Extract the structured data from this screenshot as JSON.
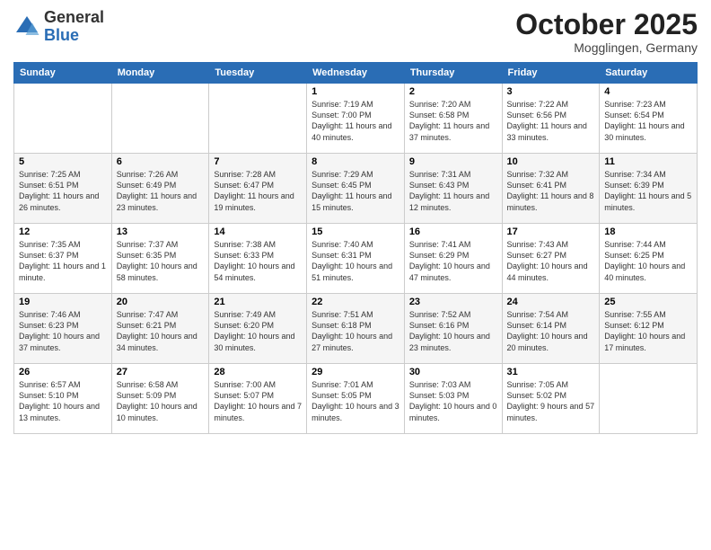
{
  "logo": {
    "general": "General",
    "blue": "Blue"
  },
  "title": {
    "month": "October 2025",
    "location": "Mogglingen, Germany"
  },
  "headers": [
    "Sunday",
    "Monday",
    "Tuesday",
    "Wednesday",
    "Thursday",
    "Friday",
    "Saturday"
  ],
  "weeks": [
    [
      {
        "day": "",
        "info": ""
      },
      {
        "day": "",
        "info": ""
      },
      {
        "day": "",
        "info": ""
      },
      {
        "day": "1",
        "info": "Sunrise: 7:19 AM\nSunset: 7:00 PM\nDaylight: 11 hours and 40 minutes."
      },
      {
        "day": "2",
        "info": "Sunrise: 7:20 AM\nSunset: 6:58 PM\nDaylight: 11 hours and 37 minutes."
      },
      {
        "day": "3",
        "info": "Sunrise: 7:22 AM\nSunset: 6:56 PM\nDaylight: 11 hours and 33 minutes."
      },
      {
        "day": "4",
        "info": "Sunrise: 7:23 AM\nSunset: 6:54 PM\nDaylight: 11 hours and 30 minutes."
      }
    ],
    [
      {
        "day": "5",
        "info": "Sunrise: 7:25 AM\nSunset: 6:51 PM\nDaylight: 11 hours and 26 minutes."
      },
      {
        "day": "6",
        "info": "Sunrise: 7:26 AM\nSunset: 6:49 PM\nDaylight: 11 hours and 23 minutes."
      },
      {
        "day": "7",
        "info": "Sunrise: 7:28 AM\nSunset: 6:47 PM\nDaylight: 11 hours and 19 minutes."
      },
      {
        "day": "8",
        "info": "Sunrise: 7:29 AM\nSunset: 6:45 PM\nDaylight: 11 hours and 15 minutes."
      },
      {
        "day": "9",
        "info": "Sunrise: 7:31 AM\nSunset: 6:43 PM\nDaylight: 11 hours and 12 minutes."
      },
      {
        "day": "10",
        "info": "Sunrise: 7:32 AM\nSunset: 6:41 PM\nDaylight: 11 hours and 8 minutes."
      },
      {
        "day": "11",
        "info": "Sunrise: 7:34 AM\nSunset: 6:39 PM\nDaylight: 11 hours and 5 minutes."
      }
    ],
    [
      {
        "day": "12",
        "info": "Sunrise: 7:35 AM\nSunset: 6:37 PM\nDaylight: 11 hours and 1 minute."
      },
      {
        "day": "13",
        "info": "Sunrise: 7:37 AM\nSunset: 6:35 PM\nDaylight: 10 hours and 58 minutes."
      },
      {
        "day": "14",
        "info": "Sunrise: 7:38 AM\nSunset: 6:33 PM\nDaylight: 10 hours and 54 minutes."
      },
      {
        "day": "15",
        "info": "Sunrise: 7:40 AM\nSunset: 6:31 PM\nDaylight: 10 hours and 51 minutes."
      },
      {
        "day": "16",
        "info": "Sunrise: 7:41 AM\nSunset: 6:29 PM\nDaylight: 10 hours and 47 minutes."
      },
      {
        "day": "17",
        "info": "Sunrise: 7:43 AM\nSunset: 6:27 PM\nDaylight: 10 hours and 44 minutes."
      },
      {
        "day": "18",
        "info": "Sunrise: 7:44 AM\nSunset: 6:25 PM\nDaylight: 10 hours and 40 minutes."
      }
    ],
    [
      {
        "day": "19",
        "info": "Sunrise: 7:46 AM\nSunset: 6:23 PM\nDaylight: 10 hours and 37 minutes."
      },
      {
        "day": "20",
        "info": "Sunrise: 7:47 AM\nSunset: 6:21 PM\nDaylight: 10 hours and 34 minutes."
      },
      {
        "day": "21",
        "info": "Sunrise: 7:49 AM\nSunset: 6:20 PM\nDaylight: 10 hours and 30 minutes."
      },
      {
        "day": "22",
        "info": "Sunrise: 7:51 AM\nSunset: 6:18 PM\nDaylight: 10 hours and 27 minutes."
      },
      {
        "day": "23",
        "info": "Sunrise: 7:52 AM\nSunset: 6:16 PM\nDaylight: 10 hours and 23 minutes."
      },
      {
        "day": "24",
        "info": "Sunrise: 7:54 AM\nSunset: 6:14 PM\nDaylight: 10 hours and 20 minutes."
      },
      {
        "day": "25",
        "info": "Sunrise: 7:55 AM\nSunset: 6:12 PM\nDaylight: 10 hours and 17 minutes."
      }
    ],
    [
      {
        "day": "26",
        "info": "Sunrise: 6:57 AM\nSunset: 5:10 PM\nDaylight: 10 hours and 13 minutes."
      },
      {
        "day": "27",
        "info": "Sunrise: 6:58 AM\nSunset: 5:09 PM\nDaylight: 10 hours and 10 minutes."
      },
      {
        "day": "28",
        "info": "Sunrise: 7:00 AM\nSunset: 5:07 PM\nDaylight: 10 hours and 7 minutes."
      },
      {
        "day": "29",
        "info": "Sunrise: 7:01 AM\nSunset: 5:05 PM\nDaylight: 10 hours and 3 minutes."
      },
      {
        "day": "30",
        "info": "Sunrise: 7:03 AM\nSunset: 5:03 PM\nDaylight: 10 hours and 0 minutes."
      },
      {
        "day": "31",
        "info": "Sunrise: 7:05 AM\nSunset: 5:02 PM\nDaylight: 9 hours and 57 minutes."
      },
      {
        "day": "",
        "info": ""
      }
    ]
  ]
}
